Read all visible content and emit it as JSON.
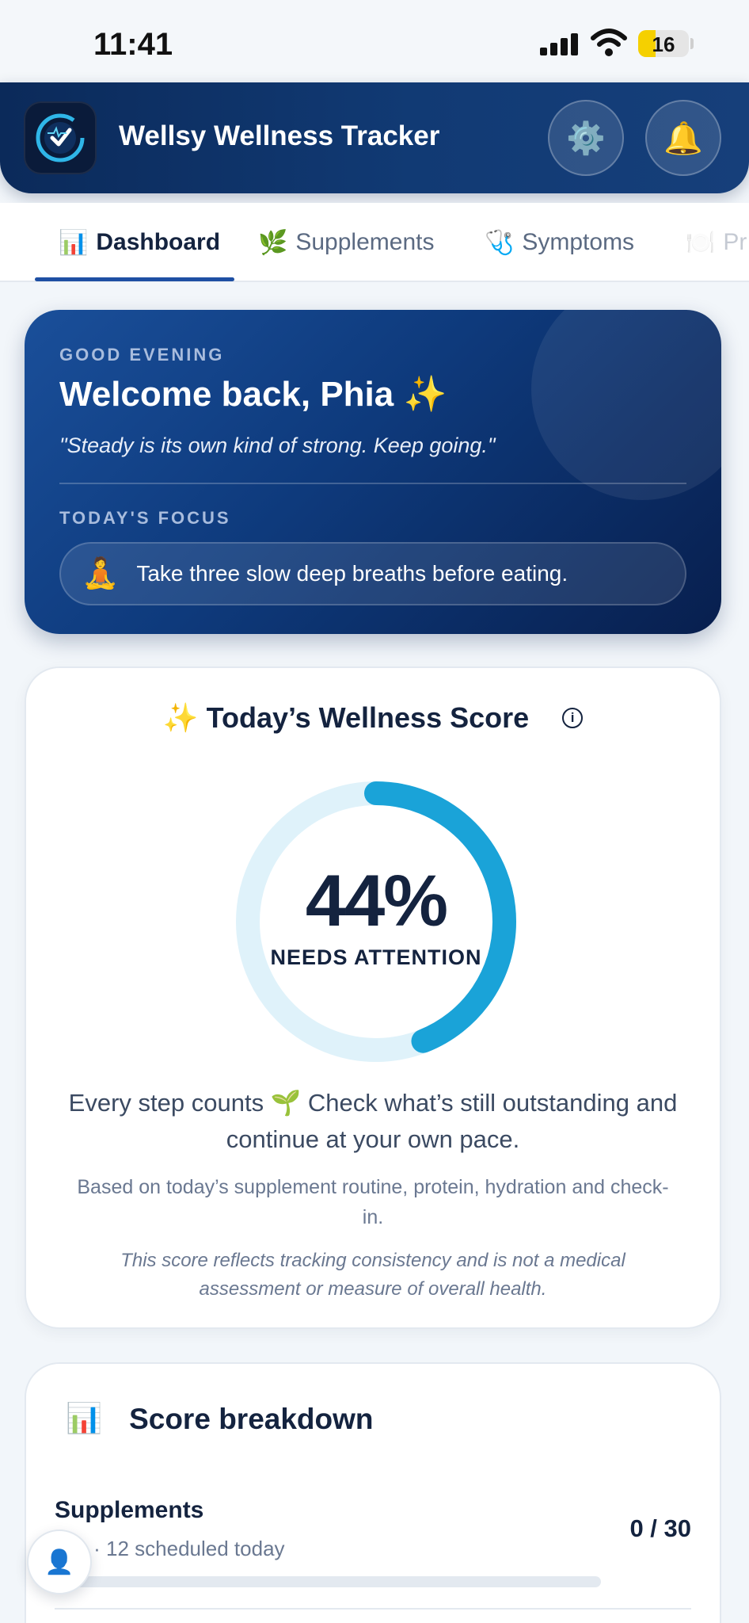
{
  "status_bar": {
    "time": "11:41",
    "battery": "16"
  },
  "header": {
    "title": "Wellsy Wellness Tracker",
    "settings_icon": "⚙️",
    "bell_icon": "🔔"
  },
  "tabs": [
    {
      "icon": "📊",
      "label": "Dashboard"
    },
    {
      "icon": "🌿",
      "label": "Supplements"
    },
    {
      "icon": "🩺",
      "label": "Symptoms"
    },
    {
      "icon": "🍽️",
      "label": "Pr"
    }
  ],
  "welcome": {
    "greeting": "GOOD EVENING",
    "title": "Welcome back, Phia ✨",
    "quote": "\"Steady is its own kind of strong. Keep going.\"",
    "focus_label": "TODAY'S FOCUS",
    "focus_icon": "🧘",
    "focus_text": "Take three slow deep breaths before eating."
  },
  "score": {
    "title": "✨ Today’s Wellness Score",
    "info": "i",
    "value_text": "44%",
    "value": 44,
    "status": "NEEDS ATTENTION",
    "message": "Every step counts 🌱 Check what’s still outstanding and continue at your own pace.",
    "basis": "Based on today’s supplement routine, protein, hydration and check-in.",
    "disclaimer": "This score reflects tracking consistency and is not a medical assessment or measure of overall health.",
    "ring_track_color": "#dff2fa",
    "ring_color": "#1aa3d8"
  },
  "breakdown": {
    "icon": "📊",
    "title": "Score breakdown",
    "rows": [
      {
        "title": "Supplements",
        "subtitle": "ken · 12 scheduled today",
        "value": "0 / 30",
        "progress": 0
      }
    ]
  },
  "fab": {
    "icon": "👤"
  }
}
